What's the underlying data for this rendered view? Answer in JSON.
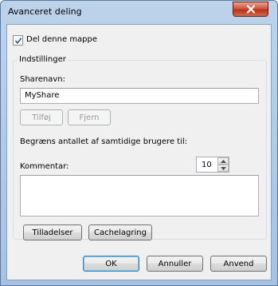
{
  "window": {
    "title": "Avanceret deling"
  },
  "share_checkbox": {
    "label": "Del denne mappe",
    "checked": true
  },
  "settings": {
    "group_title": "Indstillinger",
    "share_name_label": "Sharenavn:",
    "share_name_value": "MyShare",
    "add_label": "Tilføj",
    "remove_label": "Fjern",
    "limit_label": "Begræns antallet af samtidige brugere til:",
    "limit_value": "10",
    "comment_label": "Kommentar:",
    "comment_value": "",
    "permissions_label": "Tilladelser",
    "caching_label": "Cachelagring"
  },
  "footer": {
    "ok_label": "OK",
    "cancel_label": "Annuller",
    "apply_label": "Anvend"
  },
  "icons": {
    "close": "close-icon",
    "checkmark": "checkmark-icon",
    "spin_up": "chevron-up-icon",
    "spin_down": "chevron-down-icon"
  },
  "colors": {
    "title_bar": "#bcd3ea",
    "close_button": "#c4452b",
    "client_bg": "#f0f0f0"
  }
}
